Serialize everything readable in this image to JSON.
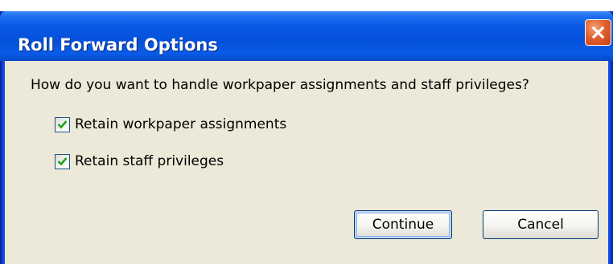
{
  "window": {
    "title": "Roll Forward Options",
    "close_icon": "close-icon"
  },
  "dialog": {
    "question": "How do you want to handle workpaper assignments and staff privileges?",
    "options": [
      {
        "label": "Retain workpaper assignments",
        "checked": true
      },
      {
        "label": "Retain staff privileges",
        "checked": true
      }
    ],
    "buttons": {
      "continue_label": "Continue",
      "cancel_label": "Cancel"
    }
  },
  "colors": {
    "titlebar": "#0a58e6",
    "client_background": "#ece9d8",
    "checkmark": "#21a121",
    "close_button": "#e0602c"
  }
}
